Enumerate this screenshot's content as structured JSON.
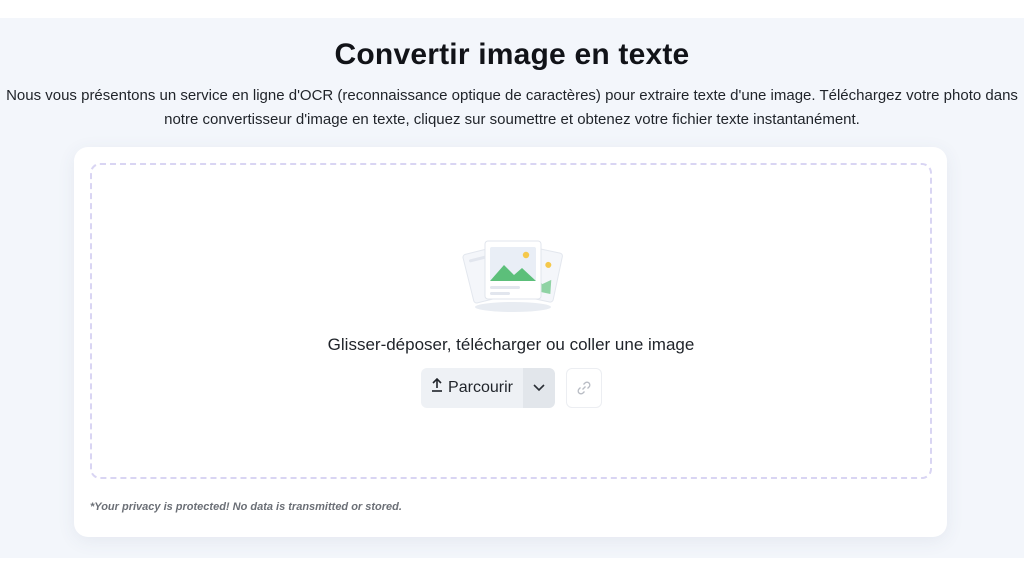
{
  "header": {
    "title": "Convertir image en texte",
    "description": "Nous vous présentons un service en ligne d'OCR (reconnaissance optique de caractères) pour extraire texte d'une image. Téléchargez votre photo dans notre convertisseur d'image en texte, cliquez sur soumettre et obtenez votre fichier texte instantanément."
  },
  "upload": {
    "illustration_icon": "image-stack-illustration",
    "drop_text": "Glisser-déposer, télécharger ou coller une image",
    "browse_label": "Parcourir",
    "browse_icon": "upload-arrow-icon",
    "dropdown_icon": "chevron-down-icon",
    "link_icon": "link-icon"
  },
  "footer": {
    "privacy": "*Your privacy is protected! No data is transmitted or stored."
  },
  "colors": {
    "background": "#f3f6fb",
    "card": "#ffffff",
    "dashed_border": "#d9d5f3",
    "button_bg": "#eef1f5",
    "illustration_green": "#5cbf7a",
    "illustration_sun": "#f5c84b"
  }
}
